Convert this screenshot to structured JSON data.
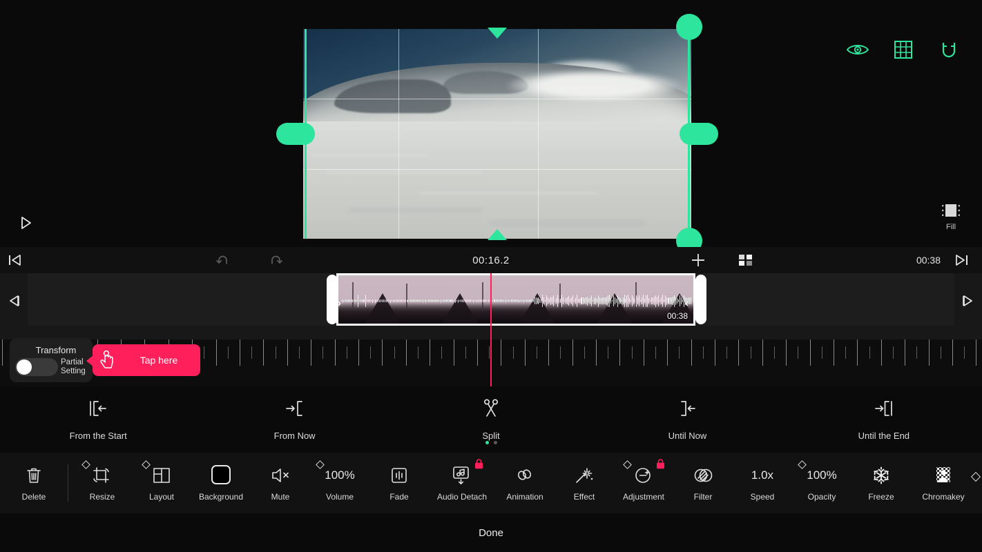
{
  "app": {
    "accent_pink": "#ff1f5a",
    "accent_green": "#2ee59d",
    "background": "#000000"
  },
  "preview": {
    "tools": [
      {
        "name": "eye-icon",
        "label": "Preview Visibility"
      },
      {
        "name": "grid-icon",
        "label": "Grid"
      },
      {
        "name": "magnet-icon",
        "label": "Snap"
      }
    ],
    "fill_label": "Fill",
    "play_label": "Play"
  },
  "timebar": {
    "undo_label": "Undo",
    "redo_label": "Redo",
    "current_time": "00:16.2",
    "total_time": "00:38",
    "add_label": "Add Clip",
    "grid_label": "Clip Grid",
    "skip_start_label": "Skip to Start",
    "skip_end_label": "Skip to End"
  },
  "timeline": {
    "clip_duration": "00:38",
    "prev_frame_label": "Previous Frame",
    "next_frame_label": "Next Frame"
  },
  "transform_popup": {
    "title": "Transform",
    "partial_setting": "Partial\nSetting",
    "partial_line1": "Partial",
    "partial_line2": "Setting",
    "toggle_state": "off",
    "tap_text": "Tap here"
  },
  "split_row": {
    "items": [
      {
        "label": "From the Start",
        "icon": "split-from-start-icon"
      },
      {
        "label": "From Now",
        "icon": "split-from-now-icon"
      },
      {
        "label": "Split",
        "icon": "scissors-icon"
      },
      {
        "label": "Until Now",
        "icon": "split-until-now-icon"
      },
      {
        "label": "Until the End",
        "icon": "split-until-end-icon"
      }
    ],
    "page_dots": 2,
    "active_dot": 0
  },
  "bottom_toolbar": {
    "items": [
      {
        "label": "Delete",
        "icon": "trash-icon",
        "keyframe": false,
        "locked": false,
        "value": ""
      },
      {
        "label": "Resize",
        "icon": "crop-rotate-icon",
        "keyframe": true,
        "locked": false,
        "value": ""
      },
      {
        "label": "Layout",
        "icon": "layout-icon",
        "keyframe": true,
        "locked": false,
        "value": ""
      },
      {
        "label": "Background",
        "icon": "background-icon",
        "keyframe": false,
        "locked": false,
        "value": ""
      },
      {
        "label": "Mute",
        "icon": "mute-icon",
        "keyframe": false,
        "locked": false,
        "value": ""
      },
      {
        "label": "Volume",
        "icon": "text-value",
        "keyframe": true,
        "locked": false,
        "value": "100%"
      },
      {
        "label": "Fade",
        "icon": "fade-icon",
        "keyframe": false,
        "locked": false,
        "value": ""
      },
      {
        "label": "Audio Detach",
        "icon": "audio-detach-icon",
        "keyframe": false,
        "locked": true,
        "value": ""
      },
      {
        "label": "Animation",
        "icon": "animation-icon",
        "keyframe": false,
        "locked": false,
        "value": ""
      },
      {
        "label": "Effect",
        "icon": "effect-wand-icon",
        "keyframe": false,
        "locked": false,
        "value": ""
      },
      {
        "label": "Adjustment",
        "icon": "adjustment-icon",
        "keyframe": true,
        "locked": true,
        "value": ""
      },
      {
        "label": "Filter",
        "icon": "filter-icon",
        "keyframe": false,
        "locked": false,
        "value": ""
      },
      {
        "label": "Speed",
        "icon": "text-value",
        "keyframe": false,
        "locked": false,
        "value": "1.0x"
      },
      {
        "label": "Opacity",
        "icon": "text-value",
        "keyframe": true,
        "locked": false,
        "value": "100%"
      },
      {
        "label": "Freeze",
        "icon": "snowflake-icon",
        "keyframe": false,
        "locked": false,
        "value": ""
      },
      {
        "label": "Chromakey",
        "icon": "chromakey-icon",
        "keyframe": false,
        "locked": false,
        "value": ""
      }
    ]
  },
  "footer": {
    "done_label": "Done"
  }
}
